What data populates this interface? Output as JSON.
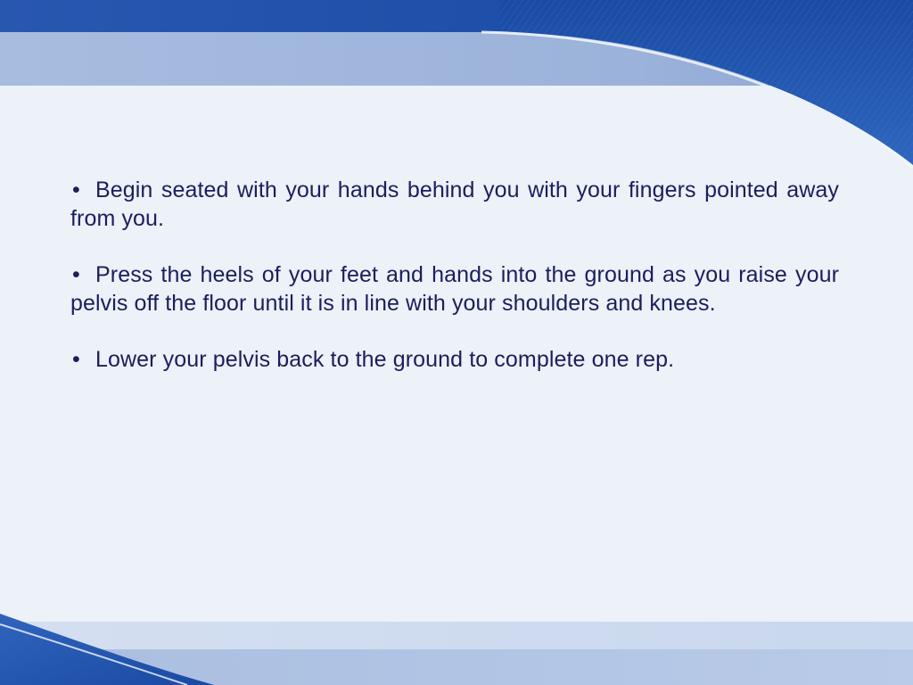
{
  "slide": {
    "bullet_symbol": "•",
    "bullets": [
      "Begin seated with your hands behind you with your fingers pointed away from you.",
      "Press the heels of your feet and hands into the ground as you raise your pelvis off the floor until it is in line with your shoulders and knees.",
      "Lower your pelvis back to the ground to complete one rep."
    ]
  },
  "theme": {
    "text_color": "#1a1f5c",
    "background_color": "#eef2f9",
    "accent_dark_blue": "#1a4ca6",
    "accent_light_blue": "#9fb4da"
  }
}
